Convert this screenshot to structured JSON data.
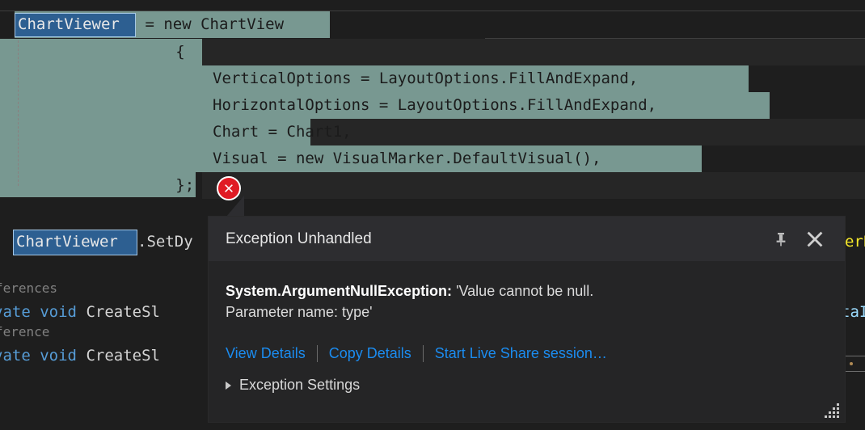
{
  "editor": {
    "lines": [
      {
        "id": "l1",
        "segments": [
          {
            "text": "ChartViewer",
            "style": "selected"
          },
          {
            "text": " = new ChartView",
            "style": "dark"
          }
        ]
      },
      {
        "id": "l2",
        "text": "            {"
      },
      {
        "id": "l3",
        "text": "                VerticalOptions = LayoutOptions.FillAndExpand,"
      },
      {
        "id": "l4",
        "text": "                HorizontalOptions = LayoutOptions.FillAndExpand,"
      },
      {
        "id": "l5",
        "text": "                Chart = Chart1,"
      },
      {
        "id": "l6",
        "text": "                Visual = new VisualMarker.DefaultVisual(),"
      },
      {
        "id": "l7",
        "text": "            };"
      },
      {
        "id": "l8",
        "segments": [
          {
            "text": "ChartViewer",
            "style": "selected-box"
          },
          {
            "text": ".SetDy",
            "style": "plain"
          },
          {
            "text": "erB",
            "style": "yellow"
          }
        ]
      },
      {
        "id": "l9",
        "text": "ferences",
        "style": "gray"
      },
      {
        "id": "l10",
        "text": "vate void CreateSl",
        "style": "mixed"
      },
      {
        "id": "l11",
        "text": "ference",
        "style": "gray"
      },
      {
        "id": "l12",
        "text": "vate void CreateSl",
        "style": "mixed"
      }
    ],
    "clipped_tokens": {
      "private_tail": "vate",
      "void": "void",
      "method": "CreateSl",
      "references_plural": "ferences",
      "references_singular": "ference",
      "yellow_tail": "erB",
      "lblue_tail": "taI",
      "setdy": ".SetDy"
    },
    "selected_symbol": "ChartViewer",
    "colors": {
      "background": "#1e1e1e",
      "highlight_band": "#789891",
      "selection": "#2d5f91",
      "keyword_blue": "#569cd6",
      "identifier_lblue": "#9cdcfe",
      "comment_gray": "#808080",
      "yellow": "#f7e92a"
    }
  },
  "error_glyph": {
    "name": "error-icon",
    "symbol": "X"
  },
  "dialog": {
    "title": "Exception Unhandled",
    "exception_type": "System.ArgumentNullException:",
    "exception_message_line1": "'Value cannot be null.",
    "exception_message_line2": "Parameter name: type'",
    "links": [
      "View Details",
      "Copy Details",
      "Start Live Share session…"
    ],
    "settings_label": "Exception Settings",
    "header_buttons": [
      {
        "name": "pin-button",
        "glyph": "pin"
      },
      {
        "name": "close-button",
        "glyph": "close"
      }
    ],
    "colors": {
      "header_bg": "#2d2d30",
      "body_bg": "#252526",
      "link": "#1b8cf0",
      "text": "#dcdcdc"
    }
  }
}
